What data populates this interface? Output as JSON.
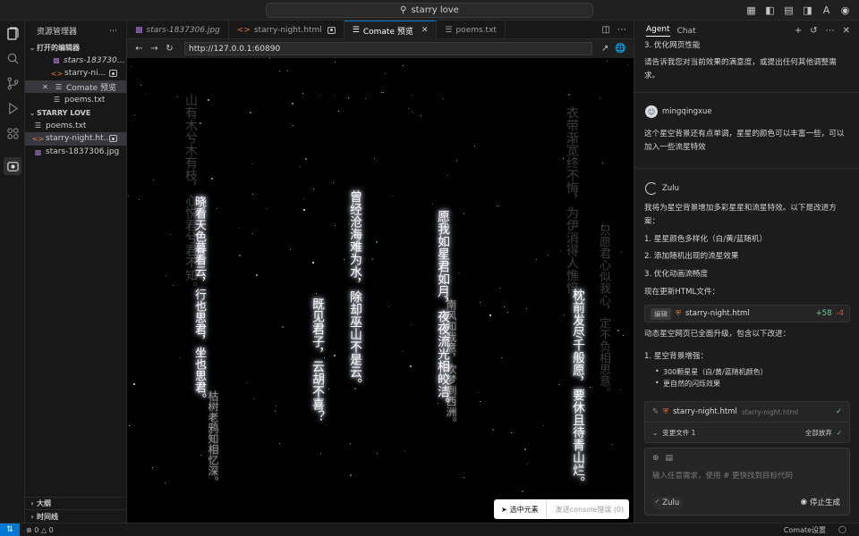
{
  "titlebar": {
    "search_text": "starry love"
  },
  "explorer": {
    "title": "资源管理器",
    "open_editors_label": "打开的编辑器",
    "open_editors": [
      {
        "name": "stars-1837306....",
        "icon": "image-icon",
        "italic": true
      },
      {
        "name": "starry-ni...",
        "icon": "html-icon",
        "dirty": true
      },
      {
        "name": "Comate 预览",
        "icon": "preview-icon",
        "selected": true
      },
      {
        "name": "poems.txt",
        "icon": "text-file-icon"
      }
    ],
    "folder_label": "STARRY LOVE",
    "files": [
      {
        "name": "poems.txt",
        "icon": "text-file-icon"
      },
      {
        "name": "starry-night.ht...",
        "icon": "html-icon",
        "dirty": true,
        "selected": true
      },
      {
        "name": "stars-1837306.jpg",
        "icon": "image-icon"
      }
    ],
    "outline_label": "大纲",
    "timeline_label": "时间线"
  },
  "tabs": [
    {
      "label": "stars-1837306.jpg",
      "icon": "image-icon",
      "italic": true
    },
    {
      "label": "starry-night.html",
      "icon": "html-icon",
      "dirty": true
    },
    {
      "label": "Comate 预览",
      "icon": "preview-icon",
      "active": true
    },
    {
      "label": "poems.txt",
      "icon": "text-file-icon"
    }
  ],
  "browser": {
    "url": "http://127.0.0.1:60890"
  },
  "preview": {
    "poems": [
      {
        "text": "山有木兮木有枝，心悦君兮君不知。",
        "style": "dim"
      },
      {
        "text": "晓看天色暮看云，行也思君，坐也思君。",
        "style": "bright"
      },
      {
        "text": "枯树老鸦知相忆深。",
        "style": "mid"
      },
      {
        "text": "曾经沧海难为水，除却巫山不是云。",
        "style": "bright"
      },
      {
        "text": "既见君子，云胡不喜？",
        "style": "bright"
      },
      {
        "text": "愿我如星君如月，夜夜流光相皎洁。",
        "style": "bright"
      },
      {
        "text": "南风知我意，吹梦到西洲。",
        "style": "mid"
      },
      {
        "text": "衣带渐宽终不悔，为伊消得人憔悴。",
        "style": "dim"
      },
      {
        "text": "枕前发尽千般愿，要休且待青山烂。",
        "style": "bright"
      },
      {
        "text": "只愿君心似我心，定不负相思意。",
        "style": "dim"
      }
    ],
    "pick_element_label": "选中元素",
    "send_console_label": "发送console错误 (0)"
  },
  "agent": {
    "tab_agent": "Agent",
    "tab_chat": "Chat",
    "prev_item": "3. 优化网页性能",
    "prev_text": "请告诉我您对当前效果的满意度，或提出任何其他调整需求。",
    "user_name": "mingqingxue",
    "user_message": "这个星空背景还有点单调，星星的颜色可以丰富一些，可以加入一些流星特效",
    "bot_name": "Zulu",
    "bot_intro": "我将为星空背景增加多彩星星和流星特效。以下是改进方案：",
    "plan": [
      "1. 星星颜色多样化（白/黄/蓝随机）",
      "2. 添加随机出现的流星效果",
      "3. 优化动画流畅度"
    ],
    "update_text": "现在更新HTML文件：",
    "edit_tag": "编辑",
    "edit_file": "starry-night.html",
    "added": "+58",
    "removed": "-4",
    "upgraded_text": "动态星空网页已全面升级，包含以下改进：",
    "sub_heading": "1. 星空背景增强：",
    "bullets": [
      "300颗星星（白/黄/蓝随机颜色）",
      "更自然的闪烁效果"
    ],
    "change_file": "starry-night.html",
    "change_file_sub": "starry-night.html",
    "changed_files": "变更文件 1",
    "discard_all": "全部放弃",
    "input_placeholder": "输入任意需求，使用 # 更快找到目标代码",
    "model": "Zulu",
    "stop_label": "停止生成"
  },
  "status": {
    "errors": "0",
    "warnings": "0",
    "comate_settings": "Comate设置"
  }
}
